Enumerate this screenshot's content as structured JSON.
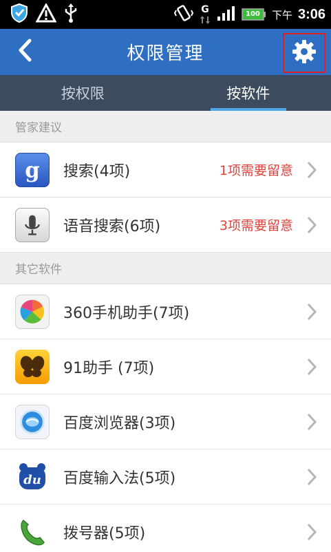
{
  "status_bar": {
    "ampm": "下午",
    "time": "3:06",
    "network_type": "G",
    "battery_level": "100",
    "icons": [
      "shield-icon",
      "warning-icon",
      "usb-icon",
      "vibrate-icon",
      "data-arrows-icon",
      "signal-icon",
      "battery-icon"
    ]
  },
  "header": {
    "title": "权限管理",
    "back_icon": "back-arrow-icon",
    "settings_icon": "gear-icon"
  },
  "tabs": [
    {
      "label": "按权限",
      "active": false
    },
    {
      "label": "按软件",
      "active": true
    }
  ],
  "sections": [
    {
      "title": "管家建议",
      "items": [
        {
          "label": "搜索(4项)",
          "warning": "1项需要留意",
          "icon": "google-search-icon"
        },
        {
          "label": "语音搜索(6项)",
          "warning": "3项需要留意",
          "icon": "microphone-icon"
        }
      ]
    },
    {
      "title": "其它软件",
      "items": [
        {
          "label": "360手机助手(7项)",
          "icon": "360-assistant-icon"
        },
        {
          "label": " 91助手 (7项)",
          "icon": "91-assistant-icon"
        },
        {
          "label": "百度浏览器(3项)",
          "icon": "baidu-browser-icon"
        },
        {
          "label": "百度输入法(5项)",
          "icon": "baidu-input-icon"
        },
        {
          "label": "拨号器(5项)",
          "icon": "phone-dialer-icon"
        }
      ]
    }
  ],
  "colors": {
    "title_bar": "#2e6ec3",
    "tab_bar": "#3c4c5e",
    "tab_indicator": "#4fa6e8",
    "warning_text": "#e0413a",
    "highlight_box": "#e02020"
  }
}
